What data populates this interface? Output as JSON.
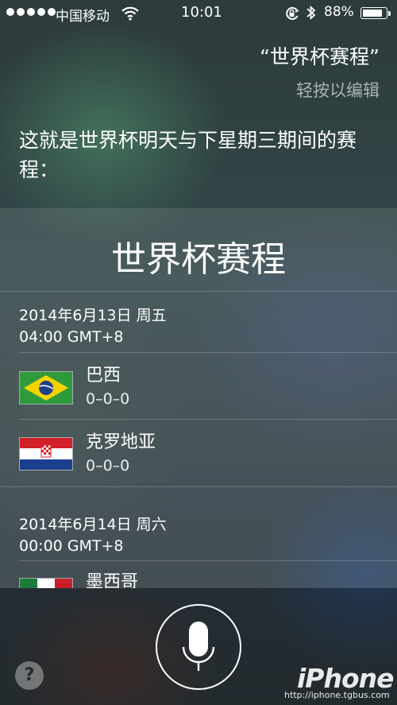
{
  "status_bar": {
    "carrier": "中国移动",
    "time": "10:01",
    "battery_percent": "88%",
    "battery_level": 0.88,
    "icons": [
      "signal-dots-icon",
      "wifi-icon",
      "orientation-lock-icon",
      "bluetooth-icon",
      "battery-icon"
    ]
  },
  "siri": {
    "query": "“世界杯赛程”",
    "edit_hint": "轻按以编辑",
    "answer": "这就是世界杯明天与下星期三期间的赛程："
  },
  "schedule": {
    "title": "世界杯赛程",
    "matches": [
      {
        "date": "2014年6月13日 周五",
        "time": "04:00 GMT+8",
        "teams": [
          {
            "name": "巴西",
            "score": "0–0–0",
            "flag": "brazil-flag-icon"
          },
          {
            "name": "克罗地亚",
            "score": "0–0–0",
            "flag": "croatia-flag-icon"
          }
        ]
      },
      {
        "date": "2014年6月14日 周六",
        "time": "00:00 GMT+8",
        "teams": [
          {
            "name": "墨西哥",
            "score": "",
            "flag": "mexico-flag-icon"
          }
        ]
      }
    ]
  },
  "controls": {
    "mic": "microphone-icon",
    "help_label": "?"
  },
  "watermark": {
    "text": "iPhone",
    "url": "http://iphone.tgbus.com"
  },
  "colors": {
    "brazil_green": "#2f9a3c",
    "brazil_yellow": "#f3d200",
    "brazil_blue": "#1f3f8a",
    "croatia_red": "#d2202b",
    "croatia_blue": "#1b3f8f",
    "mexico_green": "#1e7a3a",
    "mexico_red": "#c8202a"
  }
}
